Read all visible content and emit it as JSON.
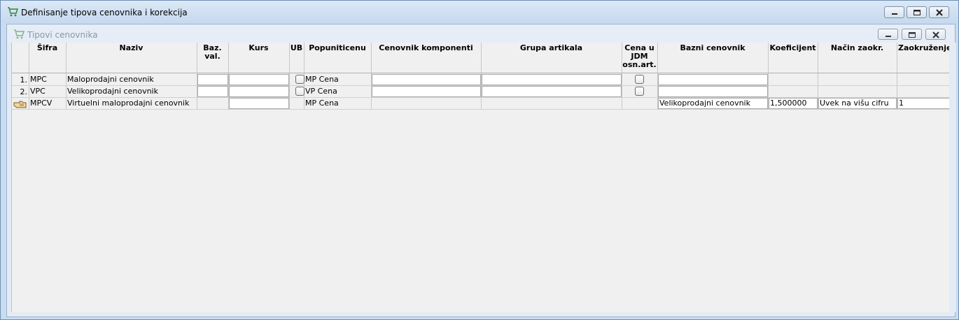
{
  "window": {
    "title": "Definisanje tipova cenovnika i korekcija"
  },
  "inner_window": {
    "title": "Tipovi cenovnika"
  },
  "columns": [
    "Šifra",
    "Naziv",
    "Baz. val.",
    "Kurs",
    "UB",
    "Popuniticenu",
    "Cenovnik komponenti",
    "Grupa artikala",
    "Cena u JDM osn.art.",
    "Bazni cenovnik",
    "Koeficijent",
    "Način zaokr.",
    "Zaokruženje"
  ],
  "header_lines": {
    "baz": [
      "Baz.",
      "val."
    ],
    "cena": [
      "Cena u",
      "JDM",
      "osn.art."
    ]
  },
  "rows": [
    {
      "num": "1.",
      "sifra": "MPC",
      "naziv": "Maloprodajni cenovnik",
      "baz_val": "",
      "kurs": "",
      "ub": false,
      "popuni": "MP Cena",
      "cenovnik_komponenti": "",
      "grupa_artikala": "",
      "cena_jdm": false,
      "bazni": "",
      "koef": "",
      "nacin": "",
      "zaokr": ""
    },
    {
      "num": "2.",
      "sifra": "VPC",
      "naziv": "Velikoprodajni cenovnik",
      "baz_val": "",
      "kurs": "",
      "ub": false,
      "popuni": "VP Cena",
      "cenovnik_komponenti": "",
      "grupa_artikala": "",
      "cena_jdm": false,
      "bazni": "",
      "koef": "",
      "nacin": "",
      "zaokr": ""
    },
    {
      "num": "",
      "sifra": "MPCV",
      "naziv": "Virtuelni maloprodajni cenovnik",
      "baz_val": "",
      "kurs": "",
      "popuni": "MP Cena",
      "cenovnik_komponenti": "",
      "grupa_artikala": "",
      "bazni": "Velikoprodajni cenovnik",
      "koef": "1,500000",
      "nacin": "Uvek na višu cifru",
      "zaokr": "1"
    }
  ],
  "icons": {
    "app": "shopping-cart-icon",
    "current_row": "pointing-hand-icon"
  }
}
